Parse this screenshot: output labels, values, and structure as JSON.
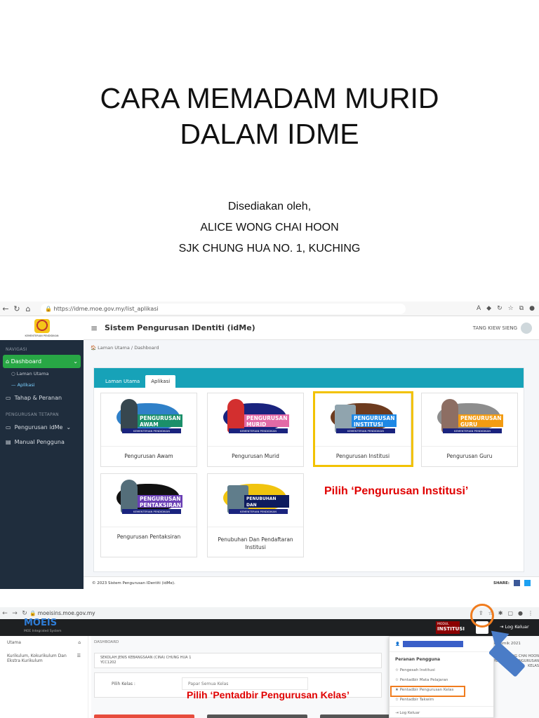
{
  "slide": {
    "title_line1": "CARA MEMADAM MURID",
    "title_line2": "DALAM IDME",
    "prepared_by": "Disediakan oleh,",
    "author": "ALICE WONG CHAI HOON",
    "school": "SJK CHUNG HUA NO. 1, KUCHING"
  },
  "shot1": {
    "url": "https://idme.moe.gov.my/list_aplikasi",
    "crest_label": "KEMENTERIAN PENDIDIKAN",
    "header_title": "Sistem Pengurusan IDentiti (idMe)",
    "user_name": "TANG KIEW SIENG",
    "breadcrumb": "🏠 Laman Utama  /  Dashboard",
    "sidebar": {
      "section1": "NAVIGASI",
      "dashboard": "Dashboard",
      "laman_utama": "Laman Utama",
      "aplikasi": "Aplikasi",
      "tahap": "Tahap & Peranan",
      "section2": "PENGURUSAN TETAPAN",
      "pengurusan": "Pengurusan idMe",
      "manual": "Manual Pengguna"
    },
    "tabs": [
      "Laman Utama",
      "Aplikasi"
    ],
    "tiles": [
      {
        "banner": "PENGURUSAN AWAM",
        "kp": "KEMENTERIAN PENDIDIKAN",
        "caption": "Pengurusan Awam"
      },
      {
        "banner": "PENGURUSAN MURID",
        "kp": "KEMENTERIAN PENDIDIKAN",
        "caption": "Pengurusan Murid"
      },
      {
        "banner": "PENGURUSAN INSTITUSI",
        "kp": "KEMENTERIAN PENDIDIKAN",
        "caption": "Pengurusan Institusi"
      },
      {
        "banner": "PENGURUSAN GURU",
        "kp": "KEMENTERIAN PENDIDIKAN",
        "caption": "Pengurusan Guru"
      },
      {
        "banner": "PENGURUSAN PENTAKSIRAN",
        "kp": "KEMENTERIAN PENDIDIKAN",
        "caption": "Pengurusan Pentaksiran"
      },
      {
        "banner": "PENUBUHAN DAN PENDAFTARAN IPS",
        "kp": "KEMENTERIAN PENDIDIKAN",
        "caption": "Penubuhan Dan Pendaftaran Institusi"
      }
    ],
    "annotation": "Pilih ‘Pengurusan Institusi’",
    "footer": "© 2023 Sistem Pengurusan IDentiti (idMe).",
    "share": "SHARE:"
  },
  "shot2": {
    "url": "moeisins.moe.gov.my",
    "brand": "MOEIS",
    "brand_sub": "MOE Integrated System",
    "modul_small": "MODUL",
    "modul": "INSTITUSI",
    "logout": "Log Keluar",
    "side_items": [
      "Utama",
      "Kurikulum, Kokurikulum Dan Ekstra Kurikulum"
    ],
    "dashboard_label": "DASHBOARD",
    "school_line1": "SEKOLAH JENIS KEBANGSAAN (CINA) CHUNG HUA 1",
    "school_line2": "YCC1202",
    "pilih_label": "Pilih Kelas :",
    "pilih_value": "Papar Semua Kelas",
    "right_top": "Sesi Akademik 2021",
    "right_mid1": "ALICE WONG CHAI HOON",
    "right_mid2": "PENTADBIR PENGURUSAN KELAS",
    "menu": {
      "heading": "Peranan Pengguna",
      "items": [
        "Pengesah Institusi",
        "Pentadbir Mata Pelajaran",
        "Pentadbir Pengurusan Kelas",
        "Pentadbir Takwim"
      ],
      "logout": "Log Keluar"
    },
    "annotation": "Pilih ‘Pentadbir Pengurusan Kelas’"
  },
  "colors": {
    "sidebar_bg": "#1f2d3d",
    "active_green": "#28a745",
    "card_teal": "#17a2b8",
    "highlight_yellow": "#f2c200",
    "annotation_red": "#e00000",
    "highlight_orange": "#f07c1e",
    "arrow_blue": "#4a7cc7"
  }
}
